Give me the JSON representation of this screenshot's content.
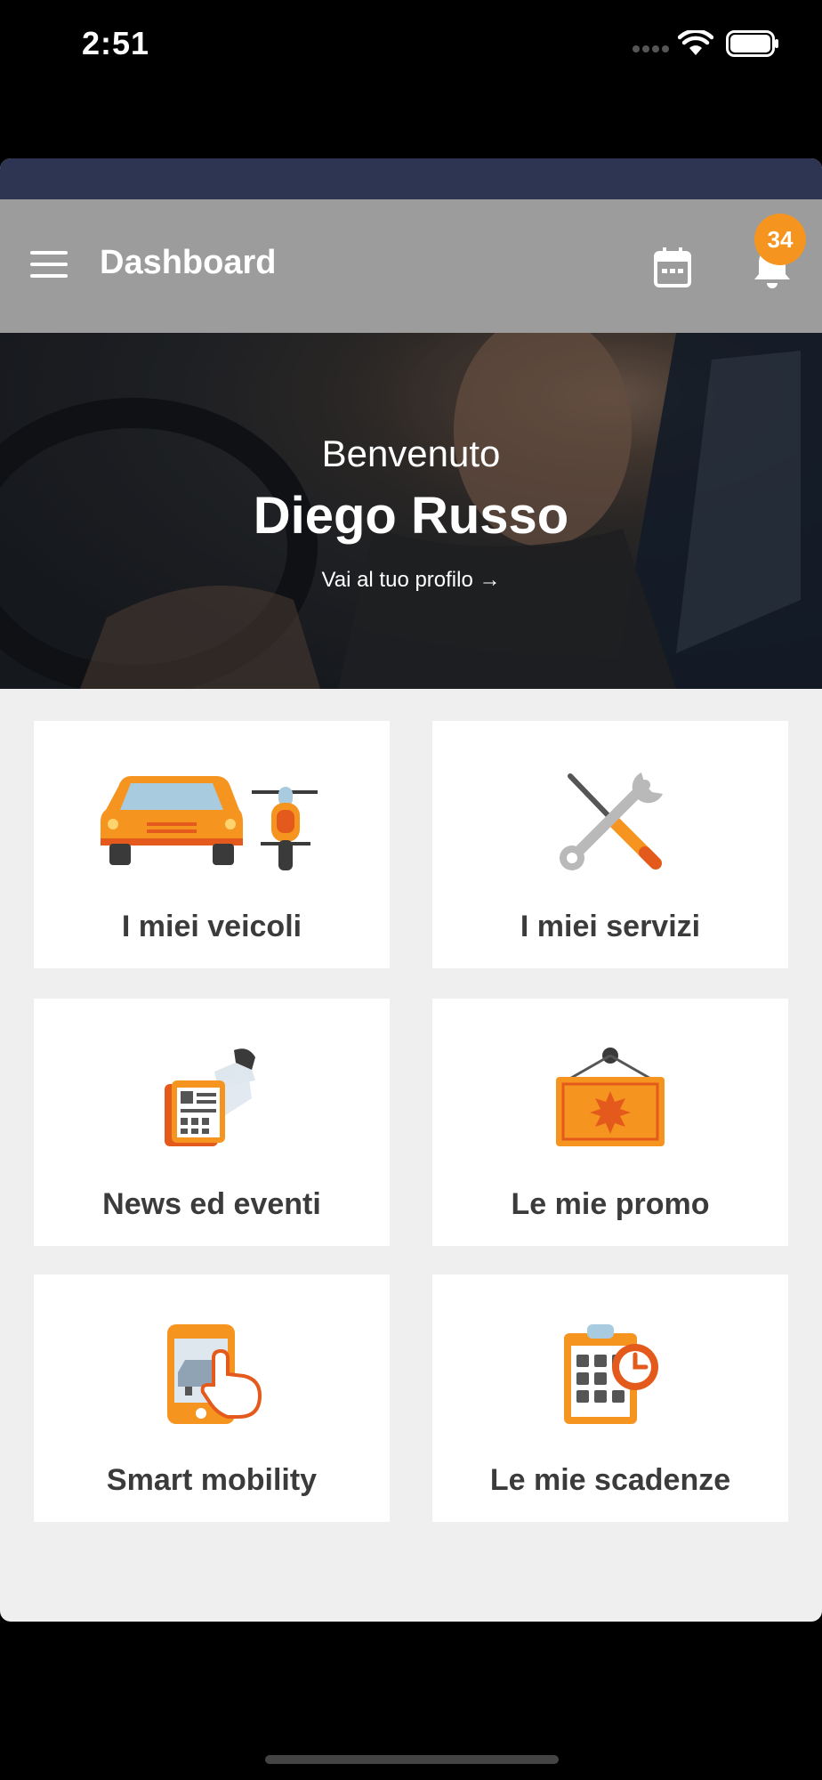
{
  "status_bar": {
    "time": "2:51"
  },
  "app_bar": {
    "title": "Dashboard",
    "notification_count": "34"
  },
  "hero": {
    "welcome": "Benvenuto",
    "user_name": "Diego Russo",
    "profile_link": "Vai al tuo profilo →"
  },
  "tiles": [
    {
      "label": "I miei veicoli",
      "icon": "vehicles-icon"
    },
    {
      "label": "I miei servizi",
      "icon": "tools-icon"
    },
    {
      "label": "News ed eventi",
      "icon": "news-icon"
    },
    {
      "label": "Le mie promo",
      "icon": "promo-icon"
    },
    {
      "label": "Smart mobility",
      "icon": "smart-mobility-icon"
    },
    {
      "label": "Le mie scadenze",
      "icon": "deadlines-icon"
    }
  ],
  "colors": {
    "accent": "#f5941e",
    "app_bar": "#9c9c9c",
    "top_strip": "#2e3552",
    "background": "#efefef"
  }
}
